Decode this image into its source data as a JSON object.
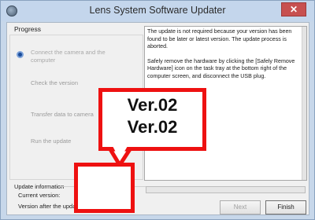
{
  "window": {
    "title": "Lens System Software Updater",
    "close_label": "✕"
  },
  "progress": {
    "label": "Progress",
    "steps": [
      {
        "line1": "Connect the camera and the",
        "line2": "computer"
      },
      {
        "line1": "Check the version",
        "line2": ""
      },
      {
        "line1": "Transfer data to camera",
        "line2": ""
      },
      {
        "line1": "Run the update",
        "line2": ""
      }
    ]
  },
  "info": {
    "paragraph1": "The update is not required because your version has been found to be later or latest version. The update process is aborted.",
    "paragraph2": "Safely remove the hardware by clicking the [Safely Remove Hardware] icon on the task tray at the bottom right of the computer screen, and disconnect the USB plug."
  },
  "update_information": {
    "label": "Update information",
    "current_version_label": "Current version:",
    "version_after_label": "Version after the update"
  },
  "buttons": {
    "next_label": "Next",
    "finish_label": "Finish"
  },
  "callout": {
    "line1": "Ver.02",
    "line2": "Ver.02",
    "border_color": "#ee1111"
  }
}
